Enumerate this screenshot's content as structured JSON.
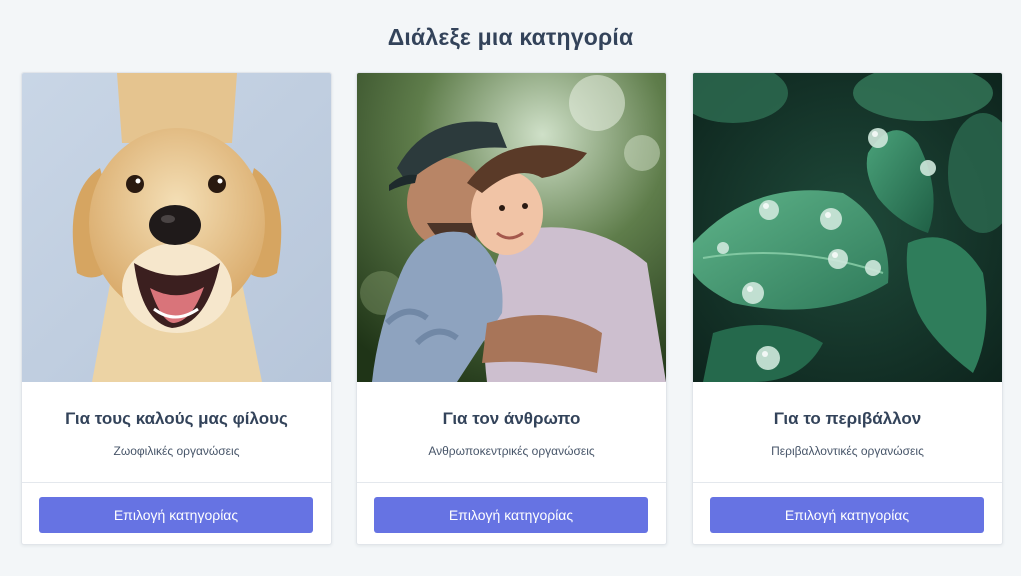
{
  "page": {
    "title": "Διάλεξε μια κατηγορία"
  },
  "cards": [
    {
      "title": "Για τους καλούς μας φίλους",
      "subtitle": "Ζωοφιλικές οργανώσεις",
      "button_label": "Επιλογή κατηγορίας",
      "image_icon": "dog-photo"
    },
    {
      "title": "Για τον άνθρωπο",
      "subtitle": "Ανθρωποκεντρικές οργανώσεις",
      "button_label": "Επιλογή κατηγορίας",
      "image_icon": "father-child-photo"
    },
    {
      "title": "Για το περιβάλλον",
      "subtitle": "Περιβαλλοντικές οργανώσεις",
      "button_label": "Επιλογή κατηγορίας",
      "image_icon": "leaves-photo"
    }
  ],
  "colors": {
    "background": "#f3f6f8",
    "accent": "#6673e3",
    "text": "#33435a"
  }
}
